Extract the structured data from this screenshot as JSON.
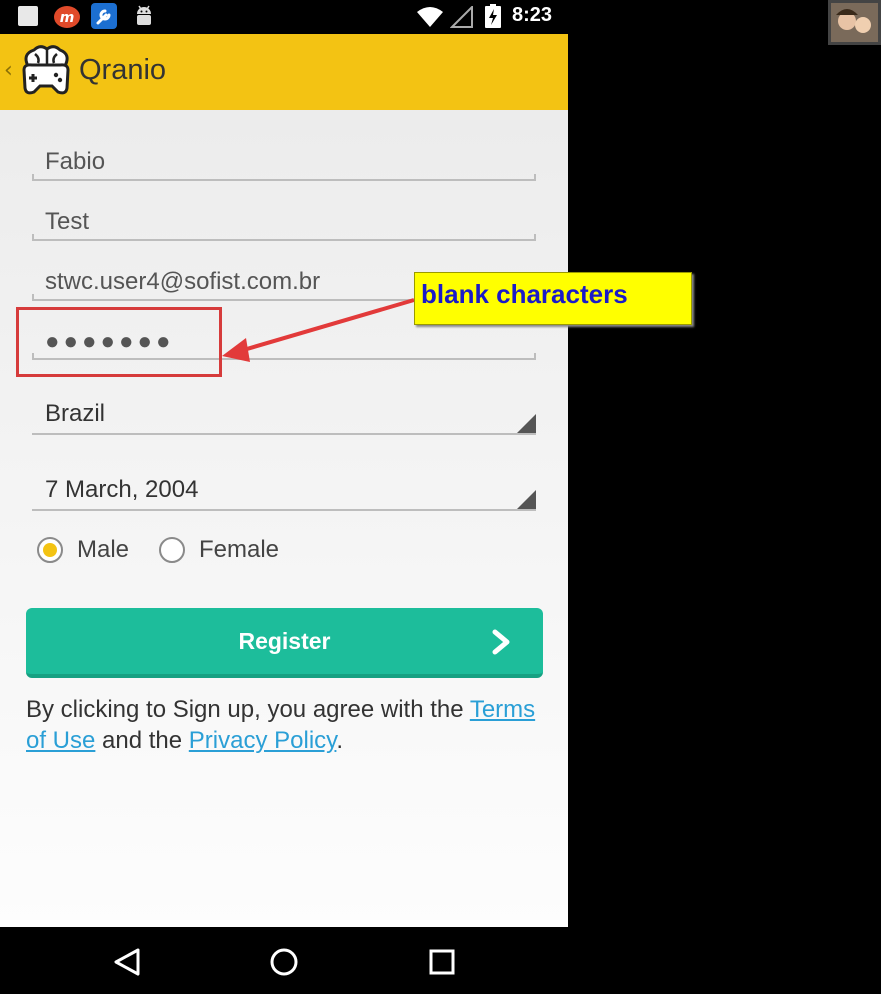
{
  "status_bar": {
    "time": "8:23",
    "icons": [
      "notification-square-icon",
      "m-app-icon",
      "tool-icon",
      "android-icon",
      "wifi-icon",
      "signal-icon",
      "battery-charging-icon"
    ]
  },
  "action_bar": {
    "title": "Qranio",
    "back_icon": "chevron-left-icon",
    "logo_icon": "brain-gamepad-logo"
  },
  "form": {
    "first_name": "Fabio",
    "last_name": "Test",
    "email": "stwc.user4@sofist.com.br",
    "password_mask": "●●●●●●●",
    "country": "Brazil",
    "birth_date": "7 March, 2004",
    "gender_options": [
      {
        "label": "Male",
        "checked": true
      },
      {
        "label": "Female",
        "checked": false
      }
    ],
    "register_label": "Register"
  },
  "legal": {
    "prefix": "By clicking to Sign up, you agree with the ",
    "terms_link": "Terms of Use",
    "middle": " and the ",
    "privacy_link": "Privacy Policy",
    "suffix": "."
  },
  "annotation": {
    "callout_text": "blank characters"
  },
  "colors": {
    "action_bar": "#f3c313",
    "register_button": "#1dbd9b",
    "link": "#2a9fd6",
    "callout_bg": "#ffff00",
    "callout_text": "#1a1ac8",
    "annotation_border": "#d63b3b"
  },
  "nav_bar": {
    "icons": [
      "back-triangle-icon",
      "home-circle-icon",
      "recents-square-icon"
    ]
  }
}
